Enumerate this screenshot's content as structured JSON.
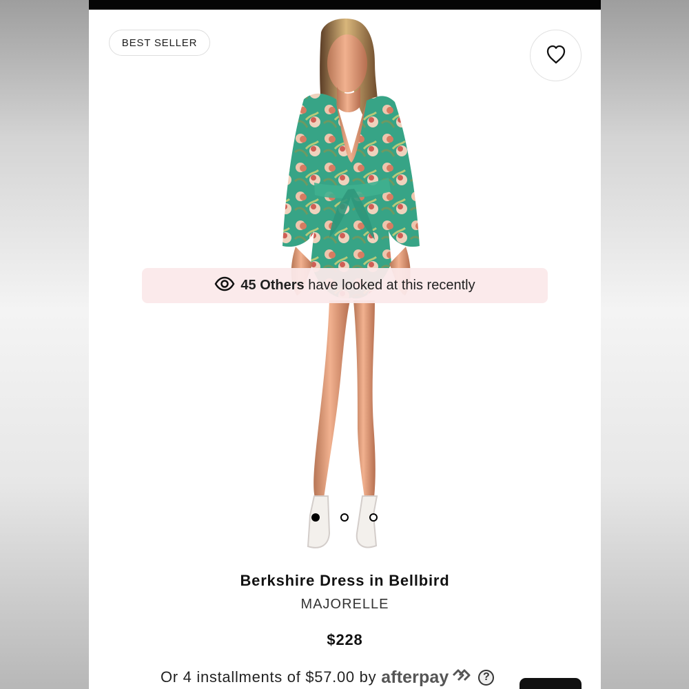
{
  "badge": {
    "label": "BEST SELLER"
  },
  "icons": {
    "favorite": "heart-outline-icon",
    "viewers": "eye-icon",
    "help": "question-mark-icon",
    "afterpay": "afterpay-logo-icon"
  },
  "viewers_banner": {
    "count_label": "45 Others",
    "message": "have looked at this recently"
  },
  "carousel": {
    "active_index": 1,
    "total": 3
  },
  "product": {
    "name": "Berkshire Dress in Bellbird",
    "brand": "MAJORELLE",
    "price": "$228"
  },
  "installments": {
    "prefix": "Or 4 installments of $57.00 by",
    "provider": "afterpay",
    "help_symbol": "?"
  },
  "colors": {
    "top_bar": "#050505",
    "banner_background": "#fbe9ea",
    "dress_green": "#37a486",
    "text_dark": "#111111"
  }
}
